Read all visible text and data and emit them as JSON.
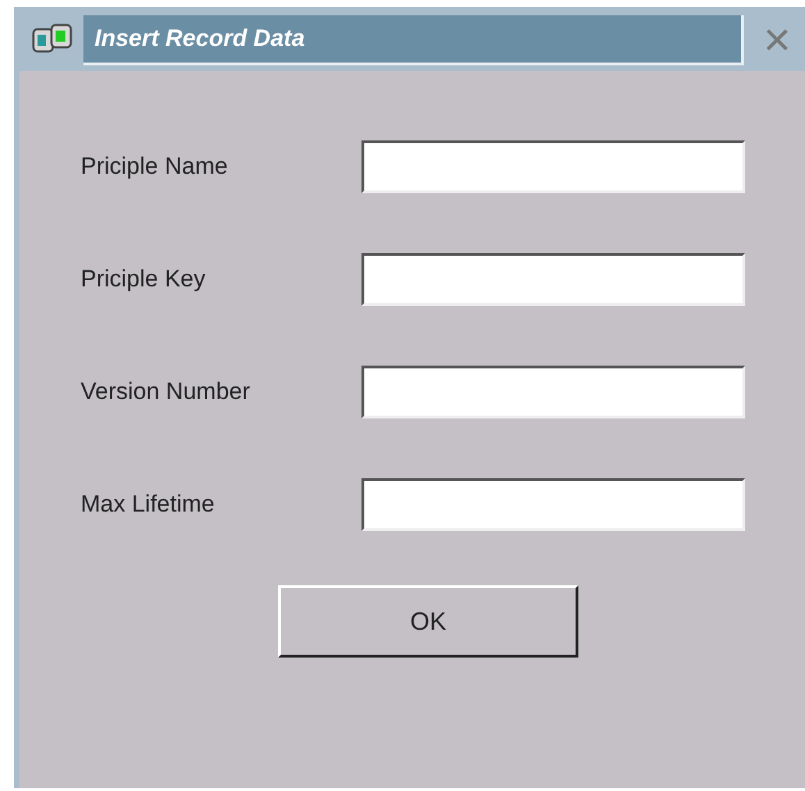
{
  "window": {
    "title": "Insert Record Data",
    "close": "×"
  },
  "fields": [
    {
      "label": "Priciple Name"
    },
    {
      "label": "Priciple Key"
    },
    {
      "label": "Version Number"
    },
    {
      "label": "Max Lifetime"
    }
  ],
  "buttons": [
    "OK"
  ]
}
